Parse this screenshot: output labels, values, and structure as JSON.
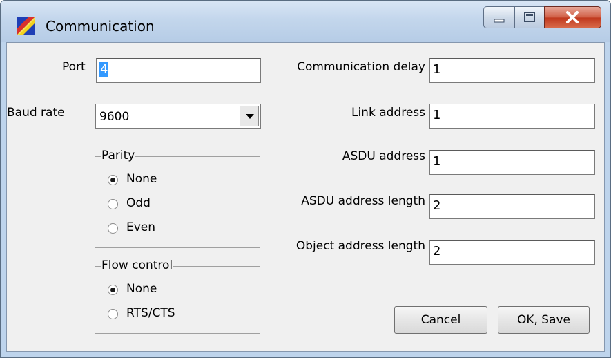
{
  "window": {
    "title": "Communication"
  },
  "left": {
    "port": {
      "label": "Port",
      "value": "4"
    },
    "baud_rate": {
      "label": "Baud rate",
      "value": "9600"
    },
    "parity": {
      "legend": "Parity",
      "options": [
        "None",
        "Odd",
        "Even"
      ],
      "selected": "None"
    },
    "flow_control": {
      "legend": "Flow control",
      "options": [
        "None",
        "RTS/CTS"
      ],
      "selected": "None"
    }
  },
  "right": {
    "fields": [
      {
        "label": "Communication delay",
        "value": "1"
      },
      {
        "label": "Link address",
        "value": "1"
      },
      {
        "label": "ASDU address",
        "value": "1"
      },
      {
        "label": "ASDU address length",
        "value": "2"
      },
      {
        "label": "Object address length",
        "value": "2"
      }
    ]
  },
  "buttons": {
    "cancel": "Cancel",
    "ok_save": "OK, Save"
  },
  "colors": {
    "title_bar": "#bed4ec",
    "close_button": "#c94a2f",
    "selection": "#3399ff"
  }
}
